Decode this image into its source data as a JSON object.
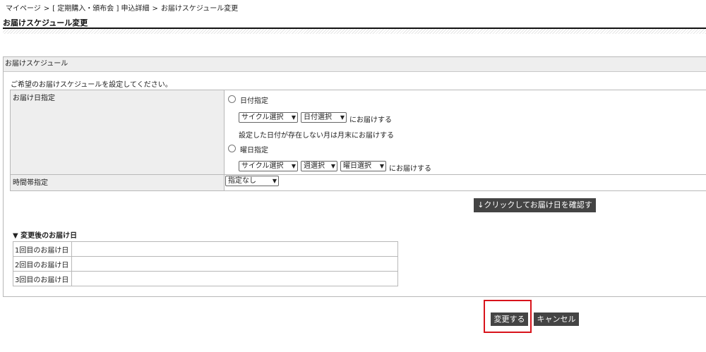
{
  "breadcrumb": {
    "home": "マイページ",
    "contract": "[ 定期購入・頒布会 ] 申込詳細",
    "current": "お届けスケジュール変更",
    "separator": ">"
  },
  "page_title": "お届けスケジュール変更",
  "panel": {
    "title": "お届けスケジュール",
    "intro": "ご希望のお届けスケジュールを設定してください。",
    "delivery_date_label": "お届け日指定",
    "option_date": {
      "label": "日付指定",
      "cycle_select": "サイクル選択",
      "day_select": "日付選択",
      "suffix": "にお届けする",
      "note": "設定した日付が存在しない月は月末にお届けする"
    },
    "option_weekday": {
      "label": "曜日指定",
      "cycle_select": "サイクル選択",
      "week_select": "週選択",
      "weekday_select": "曜日選択",
      "suffix": "にお届けする"
    },
    "time_label": "時間帯指定",
    "time_select": "指定なし",
    "confirm_button": "↓クリックしてお届け日を確認する",
    "after_heading": "▼ 変更後のお届け日",
    "delivery_rows": [
      {
        "label": "1回目のお届け日",
        "value": ""
      },
      {
        "label": "2回目のお届け日",
        "value": ""
      },
      {
        "label": "3回目のお届け日",
        "value": ""
      }
    ]
  },
  "actions": {
    "submit": "変更する",
    "cancel": "キャンセル"
  },
  "colors": {
    "button_bg": "#444444",
    "highlight": "#d8131b",
    "header_bg": "#eeeeee"
  }
}
